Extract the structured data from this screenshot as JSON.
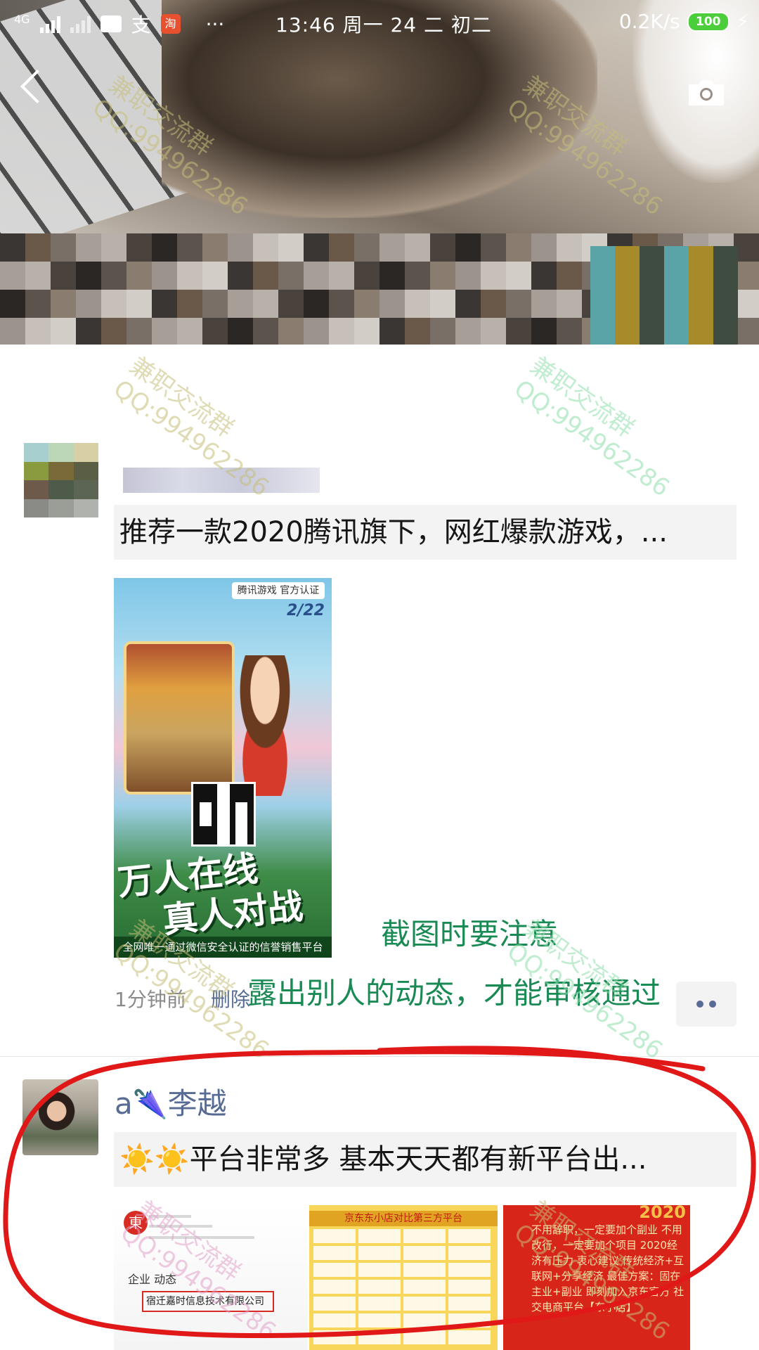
{
  "status_bar": {
    "network": "4G",
    "alipay_icon": "支",
    "taobao_icon": "淘",
    "more": "···",
    "time": "13:46 周一 24 二 初二",
    "speed": "0.2K/s",
    "battery": "100"
  },
  "watermark": {
    "line1": "兼职交流群",
    "line2": "QQ:994962286"
  },
  "post1": {
    "text": "推荐一款2020腾讯旗下，网红爆款游戏，...",
    "image": {
      "logo": "腾讯游戏 官方认证",
      "page": "2/22",
      "slogan_line1": "万人在线",
      "slogan_line2": "真人对战",
      "caption": "全网唯一通过微信安全认证的信誉销售平台"
    },
    "time": "1分钟前",
    "delete": "删除"
  },
  "note": {
    "line1": "截图时要注意",
    "line2": "露出别人的动态，才能审核通过"
  },
  "post2": {
    "name_prefix": "a",
    "name": "李越",
    "sun_icons": "☀️☀️",
    "text": "平台非常多 基本天天都有新平台出...",
    "thumb1": {
      "badge": "東",
      "tabs": "企业  动态",
      "company": "宿迁嘉时信息技术有限公司"
    },
    "thumb2": {
      "title": "京东东小店对比第三方平台"
    },
    "thumb3": {
      "year": "2020",
      "text": "不用辞职，一定要加个副业 不用改行，一定要加个项目 2020经济有压力 衷心建议 传统经济+互联网+分享经济 最佳方案：固在主业+副业 即刻加入京东官方 社交电商平台【东小店】"
    }
  },
  "colors": {
    "link": "#576b95",
    "note_green": "#1a8a55",
    "circle_red": "#e01818"
  }
}
